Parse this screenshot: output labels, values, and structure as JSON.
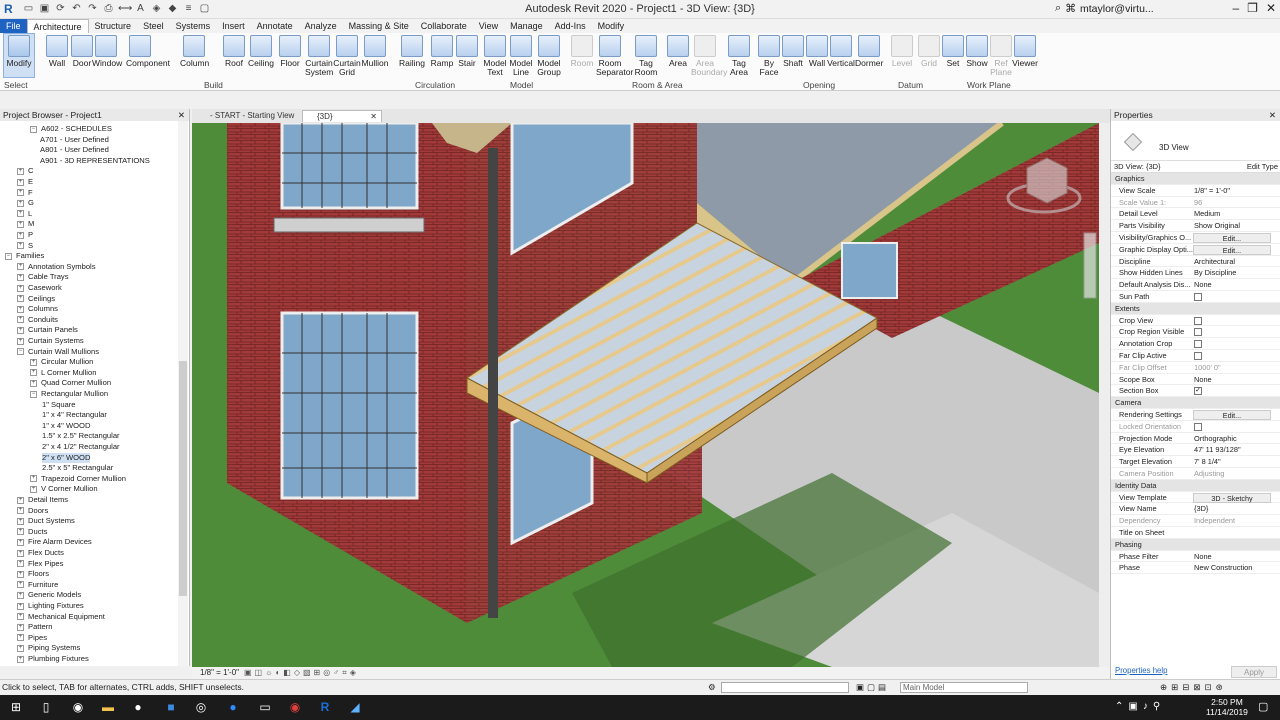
{
  "titlebar": {
    "title": "Autodesk Revit 2020 - Project1 - 3D View: {3D}",
    "user": "mtaylor@virtu..."
  },
  "menu_tabs": [
    "File",
    "Architecture",
    "Structure",
    "Steel",
    "Systems",
    "Insert",
    "Annotate",
    "Analyze",
    "Massing & Site",
    "Collaborate",
    "View",
    "Manage",
    "Add-Ins",
    "Modify"
  ],
  "ribbon": {
    "select_label": "Select",
    "tools": [
      {
        "label": "Modify"
      },
      {
        "label": "Wall"
      },
      {
        "label": "Door"
      },
      {
        "label": "Window"
      },
      {
        "label": "Component"
      },
      {
        "label": "Column"
      },
      {
        "label": "Roof"
      },
      {
        "label": "Ceiling"
      },
      {
        "label": "Floor"
      },
      {
        "label": "Curtain System"
      },
      {
        "label": "Curtain Grid"
      },
      {
        "label": "Mullion"
      },
      {
        "label": "Railing"
      },
      {
        "label": "Ramp"
      },
      {
        "label": "Stair"
      },
      {
        "label": "Model Text"
      },
      {
        "label": "Model Line"
      },
      {
        "label": "Model Group"
      },
      {
        "label": "Room"
      },
      {
        "label": "Room Separator"
      },
      {
        "label": "Tag Room"
      },
      {
        "label": "Area"
      },
      {
        "label": "Area Boundary"
      },
      {
        "label": "Tag Area"
      },
      {
        "label": "By Face"
      },
      {
        "label": "Shaft"
      },
      {
        "label": "Wall"
      },
      {
        "label": "Vertical"
      },
      {
        "label": "Dormer"
      },
      {
        "label": "Level"
      },
      {
        "label": "Grid"
      },
      {
        "label": "Set"
      },
      {
        "label": "Show"
      },
      {
        "label": "Ref Plane"
      },
      {
        "label": "Viewer"
      }
    ],
    "panels": [
      "Build",
      "Circulation",
      "Model",
      "Room & Area",
      "Opening",
      "Datum",
      "Work Plane"
    ]
  },
  "project_browser": {
    "title": "Project Browser - Project1",
    "items": [
      "A602 - SCHEDULES",
      "A701 - User Defined",
      "A801 - User Defined",
      "A901 - 3D REPRESENTATIONS",
      "C",
      "E",
      "F",
      "G",
      "L",
      "M",
      "P",
      "S",
      "Families",
      "Annotation Symbols",
      "Cable Trays",
      "Casework",
      "Ceilings",
      "Columns",
      "Conduits",
      "Curtain Panels",
      "Curtain Systems",
      "Curtain Wall Mullions",
      "Circular Mullion",
      "L Corner Mullion",
      "Quad Corner Mullion",
      "Rectangular Mullion",
      "1\" Square",
      "1\" x 4\" Rectangular",
      "1\" x 4\" WOOD",
      "1.5\" x 2.5\" Rectangular",
      "2\" x 4 1/2\" Rectangular",
      "2\" x 6\" WOOD",
      "2.5\" x 5\" Rectangular",
      "Trapezoid Corner Mullion",
      "V Corner Mullion",
      "Detail Items",
      "Doors",
      "Duct Systems",
      "Ducts",
      "Fire Alarm Devices",
      "Flex Ducts",
      "Flex Pipes",
      "Floors",
      "Furniture",
      "Generic Models",
      "Lighting Fixtures",
      "Mechanical Equipment",
      "Pattern",
      "Pipes",
      "Piping Systems",
      "Plumbing Fixtures"
    ]
  },
  "view_tabs": [
    "- START - Starting View",
    "{3D}"
  ],
  "view_scale_label": "1/8\" = 1'-0\"",
  "properties": {
    "title": "Properties",
    "type_name": "3D View",
    "selector": "3D View: {3D}",
    "edit_type": "Edit Type",
    "rows": [
      {
        "g": "Graphics"
      },
      {
        "k": "View Scale",
        "v": "1/8\" = 1'-0\"",
        "t": "input"
      },
      {
        "k": "Scale Value    1:",
        "v": "96",
        "dim": true
      },
      {
        "k": "Detail Level",
        "v": "Medium"
      },
      {
        "k": "Parts Visibility",
        "v": "Show Original"
      },
      {
        "k": "Visibility/Graphics O...",
        "v": "Edit...",
        "t": "btn"
      },
      {
        "k": "Graphic Display Opti...",
        "v": "Edit...",
        "t": "btn"
      },
      {
        "k": "Discipline",
        "v": "Architectural"
      },
      {
        "k": "Show Hidden Lines",
        "v": "By Discipline"
      },
      {
        "k": "Default Analysis Dis...",
        "v": "None"
      },
      {
        "k": "Sun Path",
        "v": "",
        "t": "cb"
      },
      {
        "g": "Extents"
      },
      {
        "k": "Crop View",
        "v": "",
        "t": "cb"
      },
      {
        "k": "Crop Region Visible",
        "v": "",
        "t": "cb"
      },
      {
        "k": "Annotation Crop",
        "v": "",
        "t": "cb"
      },
      {
        "k": "Far Clip Active",
        "v": "",
        "t": "cb"
      },
      {
        "k": "Far Clip Offset",
        "v": "1000'  0\"",
        "dim": true
      },
      {
        "k": "Scope Box",
        "v": "None"
      },
      {
        "k": "Section Box",
        "v": "✓",
        "t": "cb"
      },
      {
        "g": "Camera"
      },
      {
        "k": "Rendering Settings",
        "v": "Edit...",
        "t": "btn"
      },
      {
        "k": "Locked Orientation",
        "v": "",
        "t": "cb",
        "dim": true
      },
      {
        "k": "Projection Mode",
        "v": "Orthographic"
      },
      {
        "k": "Eye Elevation",
        "v": "47'  11 93/128\""
      },
      {
        "k": "Target Elevation",
        "v": "7'  8 1/4\""
      },
      {
        "k": "Camera Position",
        "v": "Adjusting",
        "dim": true
      },
      {
        "g": "Identity Data"
      },
      {
        "k": "View Template",
        "v": "3D - Sketchy",
        "t": "btn"
      },
      {
        "k": "View Name",
        "v": "{3D}"
      },
      {
        "k": "Dependency",
        "v": "Independent",
        "dim": true
      },
      {
        "k": "Title on Sheet",
        "v": ""
      },
      {
        "g": "Phasing"
      },
      {
        "k": "Phase Filter",
        "v": "None"
      },
      {
        "k": "Phase",
        "v": "New Construction"
      }
    ],
    "help": "Properties help",
    "apply": "Apply"
  },
  "status": {
    "message": "Click to select, TAB for alternates, CTRL adds, SHIFT unselects.",
    "model": "Main Model"
  },
  "clock": {
    "time": "2:50 PM",
    "date": "11/14/2019"
  }
}
